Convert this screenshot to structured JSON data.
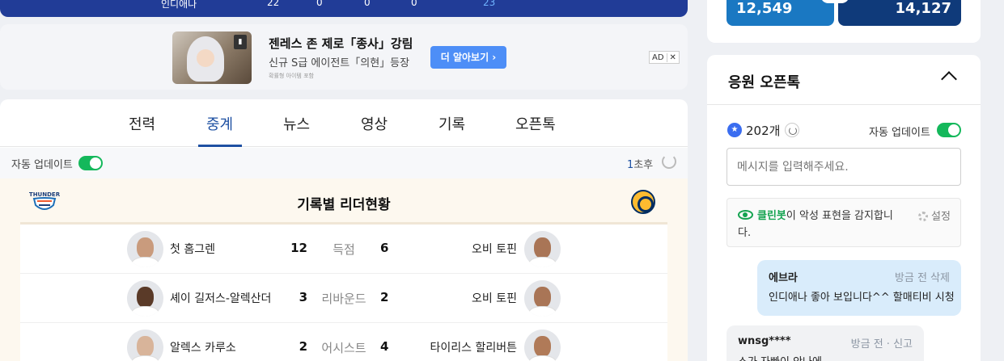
{
  "score_strip": {
    "team": "인디애나",
    "q1": "22",
    "q2": "0",
    "q3": "0",
    "q4": "0",
    "total": "23"
  },
  "ad": {
    "title": "젠레스 존 제로「종사」강림",
    "subtitle": "신규 S급 에이전트「의현」등장",
    "fine_print": "확률형 아이템 포함",
    "cta": "더 알아보기 ›",
    "ad_label": "AD",
    "close": "✕"
  },
  "tabs": [
    {
      "label": "전력"
    },
    {
      "label": "중계"
    },
    {
      "label": "뉴스"
    },
    {
      "label": "영상"
    },
    {
      "label": "기록"
    },
    {
      "label": "오픈톡"
    }
  ],
  "active_tab": "중계",
  "auto_update": {
    "label": "자동 업데이트",
    "on": true
  },
  "refresh": {
    "count": "1",
    "unit": "초후"
  },
  "leaders": {
    "title": "기록별 리더현황",
    "home_team_logo": "THUNDER",
    "rows": [
      {
        "left_player": "첫 홈그렌",
        "left_value": "12",
        "stat": "득점",
        "right_value": "6",
        "right_player": "오비 토핀"
      },
      {
        "left_player": "셰이 길저스-알렉산더",
        "left_value": "3",
        "stat": "리바운드",
        "right_value": "2",
        "right_player": "오비 토핀"
      },
      {
        "left_player": "알렉스 카루소",
        "left_value": "2",
        "stat": "어시스트",
        "right_value": "4",
        "right_player": "타이리스 할리버튼"
      }
    ]
  },
  "top_counts": {
    "left": "12,549",
    "right": "14,127"
  },
  "chat": {
    "title": "응원 오픈톡",
    "user_count": "202개",
    "auto_update_label": "자동 업데이트",
    "input_placeholder": "메시지를 입력해주세요.",
    "cleanbot_name": "클린봇",
    "cleanbot_text": "이 악성 표현을 감지합니",
    "cleanbot_text_2": "다.",
    "setting_label": "설정",
    "messages": [
      {
        "nick": "에브라",
        "meta": "방금 전  삭제",
        "text": "인디애나 좋아 보입니다^^ 할매티비 시청"
      },
      {
        "nick": "wnsg****",
        "meta": "방금 전 · 신고",
        "text": "스가 자빠이 안나에"
      }
    ]
  },
  "colors": {
    "primary": "#1e50a2",
    "toggle_on": "#14b85b",
    "strip": "#213c97",
    "cleanbot": "#14a350"
  }
}
